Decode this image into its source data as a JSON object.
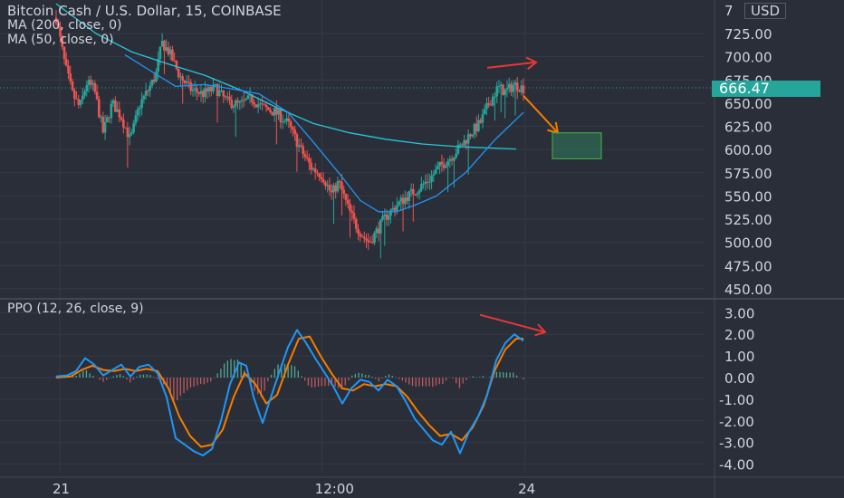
{
  "header": {
    "symbol_title": "Bitcoin Cash / U.S. Dollar, 15, COINBASE",
    "ma200_label": "MA (200, close, 0)",
    "ma50_label": "MA (50, close, 0)",
    "currency": "USD"
  },
  "price_tag": "666.47",
  "ppo_title": "PPO (12, 26, close, 9)",
  "colors": {
    "background": "#2a2e39",
    "grid": "#363a45",
    "up": "#26a69a",
    "down": "#ef5350",
    "ma200": "#26c6da",
    "ma50": "#2196f3",
    "ppo_line": "#2196f3",
    "ppo_signal": "#f57c00",
    "annotation_red": "#e53935",
    "annotation_orange": "#f57c00",
    "target_box": "#2e7d5b"
  },
  "chart_data": [
    {
      "type": "candlestick",
      "title": "Bitcoin Cash / U.S. Dollar, 15, COINBASE",
      "y_ticks": [
        "725.00",
        "700.00",
        "675.00",
        "650.00",
        "625.00",
        "600.00",
        "575.00",
        "550.00",
        "525.00",
        "500.00",
        "475.00",
        "450.00"
      ],
      "ylim": [
        445,
        745
      ],
      "x_ticks": [
        "21",
        "12:00",
        "24"
      ],
      "last_price": 666.47,
      "price_path": [
        [
          -0.1,
          742
        ],
        [
          0.15,
          690
        ],
        [
          0.35,
          660
        ],
        [
          0.55,
          645
        ],
        [
          0.75,
          672
        ],
        [
          0.95,
          665
        ],
        [
          1.2,
          618
        ],
        [
          1.45,
          650
        ],
        [
          1.7,
          635
        ],
        [
          1.95,
          610
        ],
        [
          2.2,
          648
        ],
        [
          2.45,
          665
        ],
        [
          2.65,
          680
        ],
        [
          2.82,
          715
        ],
        [
          3.02,
          705
        ],
        [
          3.3,
          680
        ],
        [
          3.6,
          665
        ],
        [
          3.95,
          660
        ],
        [
          4.3,
          666
        ],
        [
          4.6,
          652
        ],
        [
          4.95,
          648
        ],
        [
          5.3,
          655
        ],
        [
          5.6,
          645
        ],
        [
          5.95,
          640
        ],
        [
          6.3,
          628
        ],
        [
          6.65,
          600
        ],
        [
          6.95,
          580
        ],
        [
          7.25,
          572
        ],
        [
          7.5,
          552
        ],
        [
          7.7,
          565
        ],
        [
          7.95,
          538
        ],
        [
          8.15,
          520
        ],
        [
          8.4,
          505
        ],
        [
          8.55,
          500
        ],
        [
          8.75,
          512
        ],
        [
          9.0,
          528
        ],
        [
          9.3,
          540
        ],
        [
          9.6,
          550
        ],
        [
          9.9,
          558
        ],
        [
          10.2,
          568
        ],
        [
          10.5,
          582
        ],
        [
          10.8,
          592
        ],
        [
          11.1,
          605
        ],
        [
          11.35,
          618
        ],
        [
          11.6,
          628
        ],
        [
          11.85,
          650
        ],
        [
          12.1,
          667
        ],
        [
          12.3,
          662
        ],
        [
          12.55,
          670
        ],
        [
          12.8,
          666
        ]
      ],
      "ma200": [
        [
          -0.1,
          757
        ],
        [
          1,
          725
        ],
        [
          2,
          705
        ],
        [
          3,
          692
        ],
        [
          4,
          680
        ],
        [
          5,
          664
        ],
        [
          6,
          645
        ],
        [
          7,
          628
        ],
        [
          8,
          618
        ],
        [
          9,
          611
        ],
        [
          10,
          606
        ],
        [
          11,
          603
        ],
        [
          12,
          601.5
        ],
        [
          12.6,
          600.5
        ]
      ],
      "ma50": [
        [
          1.8,
          702
        ],
        [
          2.5,
          685
        ],
        [
          3.2,
          668
        ],
        [
          4,
          670
        ],
        [
          4.8,
          665
        ],
        [
          5.5,
          660
        ],
        [
          6.3,
          640
        ],
        [
          7,
          608
        ],
        [
          7.7,
          575
        ],
        [
          8.3,
          545
        ],
        [
          8.8,
          533
        ],
        [
          9.3,
          533
        ],
        [
          9.8,
          540
        ],
        [
          10.4,
          550
        ],
        [
          11.2,
          575
        ],
        [
          12,
          610
        ],
        [
          12.8,
          640
        ]
      ],
      "annotations": {
        "rising_arrow": [
          [
            11.8,
            688
          ],
          [
            13.15,
            694
          ]
        ],
        "falling_arrow": [
          [
            12.8,
            658
          ],
          [
            13.75,
            618
          ]
        ],
        "target_zone": {
          "x0": 13.6,
          "x1": 14.95,
          "y0": 590,
          "y1": 618
        }
      }
    },
    {
      "type": "line",
      "title": "PPO (12, 26, close, 9)",
      "y_ticks": [
        "3.00",
        "2.00",
        "1.00",
        "0.00",
        "-1.00",
        "-2.00",
        "-3.00",
        "-4.00"
      ],
      "ylim": [
        -4.3,
        3.4
      ],
      "series": [
        {
          "key": "ppo",
          "points": [
            [
              -0.1,
              0.05
            ],
            [
              0.2,
              0.1
            ],
            [
              0.45,
              0.3
            ],
            [
              0.7,
              0.9
            ],
            [
              0.95,
              0.6
            ],
            [
              1.2,
              0.1
            ],
            [
              1.45,
              0.35
            ],
            [
              1.7,
              0.6
            ],
            [
              1.95,
              0.05
            ],
            [
              2.2,
              0.5
            ],
            [
              2.45,
              0.6
            ],
            [
              2.7,
              0.2
            ],
            [
              2.95,
              -0.9
            ],
            [
              3.2,
              -2.8
            ],
            [
              3.45,
              -3.1
            ],
            [
              3.7,
              -3.4
            ],
            [
              3.95,
              -3.6
            ],
            [
              4.2,
              -3.3
            ],
            [
              4.45,
              -2.0
            ],
            [
              4.7,
              -0.3
            ],
            [
              4.95,
              0.7
            ],
            [
              5.15,
              0.55
            ],
            [
              5.35,
              -0.9
            ],
            [
              5.6,
              -2.1
            ],
            [
              5.85,
              -0.8
            ],
            [
              6.05,
              0.2
            ],
            [
              6.3,
              1.4
            ],
            [
              6.55,
              2.2
            ],
            [
              6.8,
              1.6
            ],
            [
              7.05,
              0.9
            ],
            [
              7.3,
              0.25
            ],
            [
              7.55,
              -0.4
            ],
            [
              7.8,
              -1.2
            ],
            [
              8.05,
              -0.5
            ],
            [
              8.3,
              -0.1
            ],
            [
              8.55,
              -0.2
            ],
            [
              8.8,
              -0.6
            ],
            [
              9.05,
              -0.1
            ],
            [
              9.3,
              -0.4
            ],
            [
              9.55,
              -1.1
            ],
            [
              9.8,
              -1.9
            ],
            [
              10.05,
              -2.4
            ],
            [
              10.3,
              -2.9
            ],
            [
              10.55,
              -3.1
            ],
            [
              10.8,
              -2.5
            ],
            [
              11.05,
              -3.5
            ],
            [
              11.3,
              -2.5
            ],
            [
              11.55,
              -1.8
            ],
            [
              11.8,
              -0.8
            ],
            [
              12.05,
              0.8
            ],
            [
              12.3,
              1.6
            ],
            [
              12.55,
              2.0
            ],
            [
              12.8,
              1.7
            ]
          ]
        },
        {
          "key": "signal",
          "points": [
            [
              -0.1,
              0.0
            ],
            [
              0.3,
              0.05
            ],
            [
              0.6,
              0.35
            ],
            [
              0.9,
              0.55
            ],
            [
              1.2,
              0.35
            ],
            [
              1.5,
              0.3
            ],
            [
              1.8,
              0.4
            ],
            [
              2.1,
              0.3
            ],
            [
              2.4,
              0.4
            ],
            [
              2.7,
              0.3
            ],
            [
              3.0,
              -0.5
            ],
            [
              3.3,
              -1.8
            ],
            [
              3.6,
              -2.7
            ],
            [
              3.9,
              -3.2
            ],
            [
              4.2,
              -3.1
            ],
            [
              4.5,
              -2.4
            ],
            [
              4.8,
              -0.9
            ],
            [
              5.1,
              0.2
            ],
            [
              5.4,
              -0.3
            ],
            [
              5.7,
              -1.2
            ],
            [
              6.0,
              -0.8
            ],
            [
              6.3,
              0.6
            ],
            [
              6.6,
              1.8
            ],
            [
              6.9,
              1.9
            ],
            [
              7.2,
              1.0
            ],
            [
              7.5,
              0.2
            ],
            [
              7.8,
              -0.5
            ],
            [
              8.1,
              -0.6
            ],
            [
              8.4,
              -0.3
            ],
            [
              8.7,
              -0.4
            ],
            [
              9.0,
              -0.3
            ],
            [
              9.3,
              -0.4
            ],
            [
              9.6,
              -0.9
            ],
            [
              9.9,
              -1.6
            ],
            [
              10.2,
              -2.2
            ],
            [
              10.5,
              -2.7
            ],
            [
              10.8,
              -2.6
            ],
            [
              11.1,
              -2.9
            ],
            [
              11.4,
              -2.3
            ],
            [
              11.7,
              -1.3
            ],
            [
              12.0,
              0.3
            ],
            [
              12.3,
              1.3
            ],
            [
              12.6,
              1.8
            ],
            [
              12.8,
              1.8
            ]
          ]
        }
      ],
      "divergence_arrow": [
        [
          11.6,
          2.9
        ],
        [
          13.4,
          2.1
        ]
      ]
    }
  ]
}
